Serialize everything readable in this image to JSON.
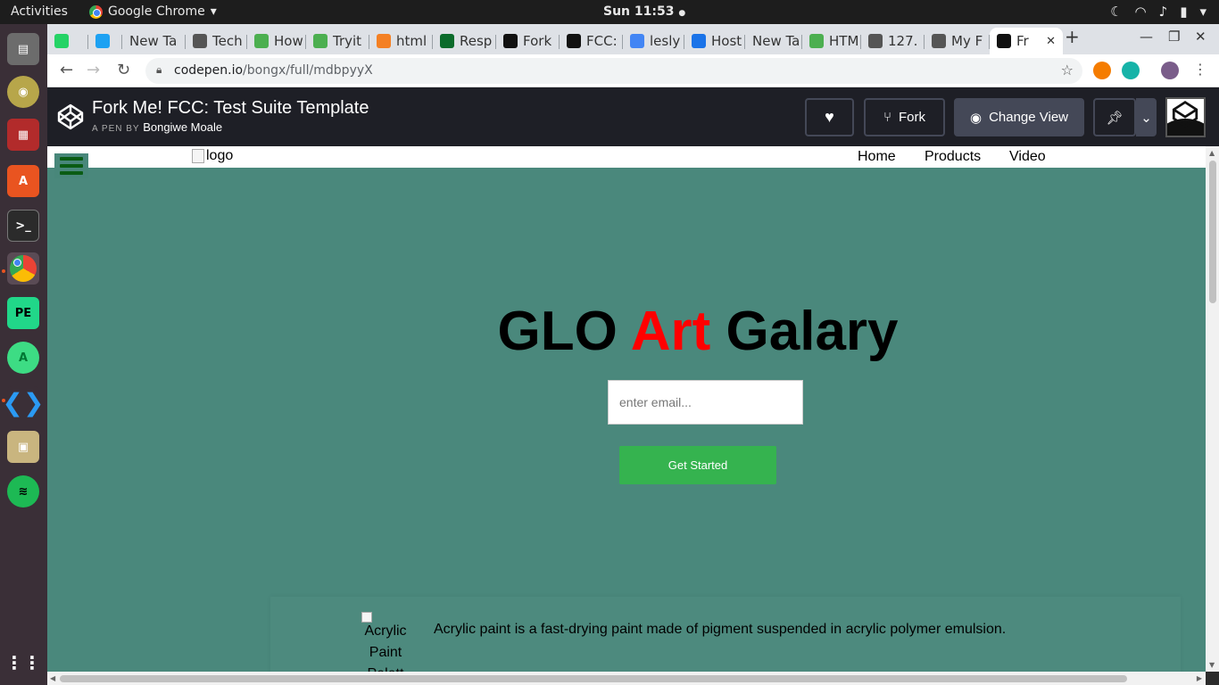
{
  "system_bar": {
    "activities": "Activities",
    "app_name": "Google Chrome",
    "clock": "Sun 11:53"
  },
  "tabs": [
    {
      "label": "",
      "icon": "whatsapp-icon",
      "color": "#25d366"
    },
    {
      "label": "",
      "icon": "twitter-icon",
      "color": "#1da1f2"
    },
    {
      "label": "New Ta",
      "icon": "",
      "color": ""
    },
    {
      "label": "Tech",
      "icon": "globe-icon",
      "color": "#555555"
    },
    {
      "label": "How",
      "icon": "w3-icon",
      "color": "#4caf50"
    },
    {
      "label": "Tryit",
      "icon": "w3-icon",
      "color": "#4caf50"
    },
    {
      "label": "html",
      "icon": "stackoverflow-icon",
      "color": "#f48024"
    },
    {
      "label": "Resp",
      "icon": "android-studio-icon",
      "color": "#0b6b2b"
    },
    {
      "label": "Fork",
      "icon": "codepen-icon",
      "color": "#111111"
    },
    {
      "label": "FCC:",
      "icon": "codepen-icon",
      "color": "#111111"
    },
    {
      "label": "lesly",
      "icon": "google-icon",
      "color": "#4285f4"
    },
    {
      "label": "Host",
      "icon": "flag-icon",
      "color": "#1a73e8"
    },
    {
      "label": "New Ta",
      "icon": "",
      "color": ""
    },
    {
      "label": "HTM",
      "icon": "w3-icon",
      "color": "#4caf50"
    },
    {
      "label": "127.",
      "icon": "globe-icon",
      "color": "#555555"
    },
    {
      "label": "My F",
      "icon": "globe-icon",
      "color": "#555555"
    },
    {
      "label": "Fr",
      "icon": "codepen-icon",
      "color": "#111111",
      "active": true
    }
  ],
  "address_bar": {
    "domain": "codepen.io",
    "path": "/bongx/full/mdbpyyX"
  },
  "codepen": {
    "title": "Fork Me! FCC: Test Suite Template",
    "byline_prefix": "A PEN BY",
    "author": "Bongiwe Moale",
    "fork_label": "Fork",
    "change_view_label": "Change View"
  },
  "page": {
    "logo_alt": "logo",
    "nav": [
      "Home",
      "Products",
      "Video"
    ],
    "hero_title_part1": "GLO ",
    "hero_title_accent": "Art",
    "hero_title_part2": " Galary",
    "email_placeholder": "enter email...",
    "button_label": "Get Started",
    "feature_img_alt_lines": [
      "Acrylic",
      "Paint",
      "Palett"
    ],
    "feature_text": "Acrylic paint is a fast-drying paint made of pigment suspended in acrylic polymer emulsion.",
    "accent_color": "#ff0000",
    "background_color": "#4a887c",
    "button_color": "#35b34f"
  }
}
